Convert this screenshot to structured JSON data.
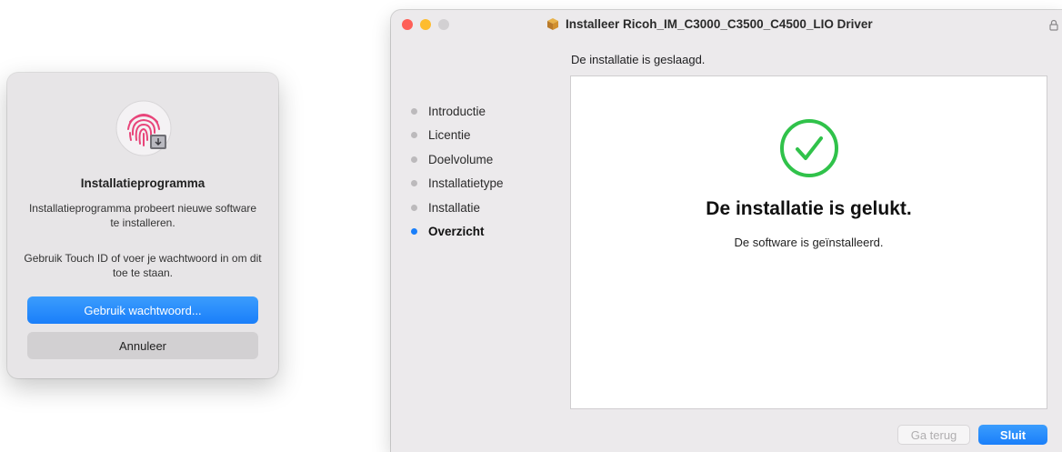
{
  "auth_dialog": {
    "title": "Installatieprogramma",
    "message": "Installatieprogramma probeert nieuwe software te installeren.",
    "touch_id_prompt": "Gebruik Touch ID of voer je wachtwoord in om dit toe te staan.",
    "use_password_label": "Gebruik wachtwoord...",
    "cancel_label": "Annuleer",
    "icon": "touch-id-fingerprint-icon"
  },
  "installer": {
    "window_title": "Installeer Ricoh_IM_C3000_C3500_C4500_LIO Driver",
    "status_line": "De installatie is geslaagd.",
    "steps": [
      {
        "label": "Introductie",
        "active": false
      },
      {
        "label": "Licentie",
        "active": false
      },
      {
        "label": "Doelvolume",
        "active": false
      },
      {
        "label": "Installatietype",
        "active": false
      },
      {
        "label": "Installatie",
        "active": false
      },
      {
        "label": "Overzicht",
        "active": true
      }
    ],
    "result_heading": "De installatie is gelukt.",
    "result_message": "De software is geïnstalleerd.",
    "back_label": "Ga terug",
    "close_label": "Sluit",
    "colors": {
      "accent": "#1a7ffa",
      "success": "#30c24a",
      "traffic_close": "#fe5f57",
      "traffic_minimize": "#febc2e",
      "traffic_zoom": "#d2d0d2"
    }
  }
}
